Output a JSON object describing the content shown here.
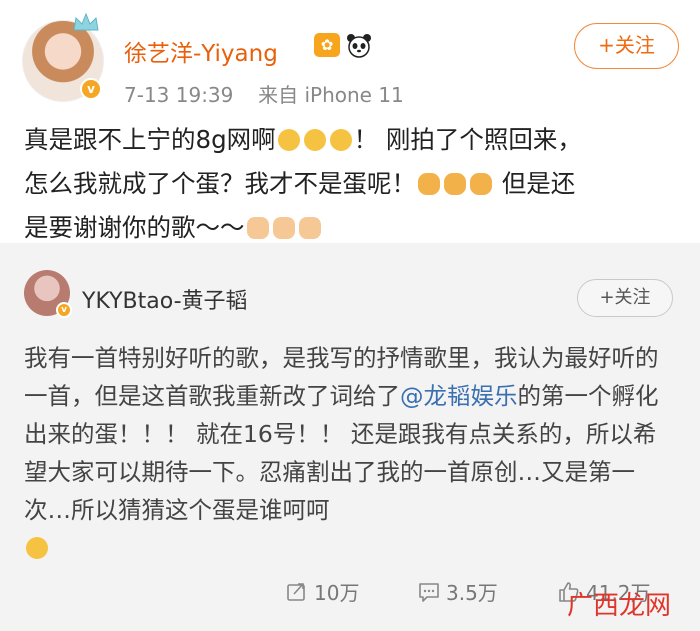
{
  "post": {
    "username": "徐艺洋-Yiyang",
    "time": "7-13 19:39",
    "source": "来自 iPhone 11",
    "follow_label": "+关注",
    "text_line1_a": "真是跟不上宁的8g网啊",
    "text_line1_b": "！ 刚拍了个照回来，",
    "text_line2_a": "怎么我就成了个蛋？我才不是蛋呢！",
    "text_line2_b": " 但是还",
    "text_line3": "是要谢谢你的歌～～"
  },
  "repost": {
    "username": "YKYBtao-黄子韬",
    "follow_label": "+关注",
    "text_a": "我有一首特别好听的歌，是我写的抒情歌里，我认为最好听的一首，但是这首歌我重新改了词给了",
    "mention": "@龙韬娱乐",
    "text_b": "的第一个孵化出来的蛋！！！ 就在16号！！ 还是跟我有点关系的，所以希望大家可以期待一下。忍痛割出了我的一首原创…又是第一次…所以猜猜这个蛋是谁呵呵"
  },
  "actions": {
    "repost_count": "10万",
    "comment_count": "3.5万",
    "like_count": "41.2万"
  },
  "watermark": {
    "text": "广西龙网"
  },
  "colors": {
    "username": "#e8600c",
    "follow_border": "#f28a3d",
    "mention": "#3a6fb0",
    "verified": "#f5a623"
  }
}
